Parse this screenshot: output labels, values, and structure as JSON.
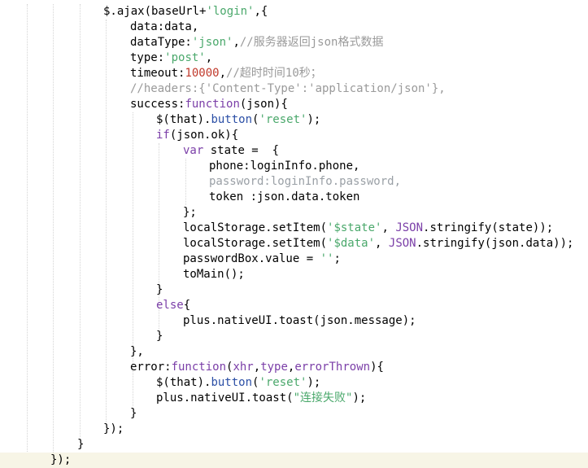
{
  "editor": {
    "language": "javascript",
    "colors": {
      "string": "#4aa86b",
      "comment": "#9a9a9a",
      "number": "#c0392b",
      "keyword": "#7b3fa8",
      "function": "#2b4fa6",
      "active_line_bg": "#f7f5e6"
    },
    "lines": [
      {
        "indent": 4,
        "tokens": [
          {
            "t": "$.ajax(baseUrl+"
          },
          {
            "t": "'login'",
            "c": "str"
          },
          {
            "t": ",{"
          }
        ]
      },
      {
        "indent": 5,
        "tokens": [
          {
            "t": "data:data,"
          }
        ]
      },
      {
        "indent": 5,
        "tokens": [
          {
            "t": "dataType:"
          },
          {
            "t": "'json'",
            "c": "str"
          },
          {
            "t": ","
          },
          {
            "t": "//服务器返回json格式数据",
            "c": "cmt"
          }
        ]
      },
      {
        "indent": 5,
        "tokens": [
          {
            "t": "type:"
          },
          {
            "t": "'post'",
            "c": "str"
          },
          {
            "t": ","
          }
        ]
      },
      {
        "indent": 5,
        "tokens": [
          {
            "t": "timeout:"
          },
          {
            "t": "10000",
            "c": "num"
          },
          {
            "t": ","
          },
          {
            "t": "//超时时间10秒；",
            "c": "cmt"
          }
        ]
      },
      {
        "indent": 5,
        "tokens": [
          {
            "t": "//headers:{'Content-Type':'application/json'},",
            "c": "cmt"
          }
        ]
      },
      {
        "indent": 5,
        "tokens": [
          {
            "t": "success:"
          },
          {
            "t": "function",
            "c": "kw"
          },
          {
            "t": "(json){"
          }
        ]
      },
      {
        "indent": 6,
        "tokens": [
          {
            "t": "$(that)."
          },
          {
            "t": "button",
            "c": "fn"
          },
          {
            "t": "("
          },
          {
            "t": "'reset'",
            "c": "str"
          },
          {
            "t": ");"
          }
        ]
      },
      {
        "indent": 6,
        "tokens": [
          {
            "t": "if",
            "c": "kw"
          },
          {
            "t": "(json.ok){"
          }
        ]
      },
      {
        "indent": 7,
        "tokens": [
          {
            "t": "var",
            "c": "kw"
          },
          {
            "t": " state =  {"
          }
        ]
      },
      {
        "indent": 8,
        "tokens": [
          {
            "t": "phone:loginInfo.phone,"
          }
        ]
      },
      {
        "indent": 8,
        "tokens": [
          {
            "t": "password:loginInfo.password,",
            "c": "dim"
          }
        ]
      },
      {
        "indent": 8,
        "tokens": [
          {
            "t": "token :json.data.token"
          }
        ]
      },
      {
        "indent": 7,
        "tokens": [
          {
            "t": "};"
          }
        ]
      },
      {
        "indent": 7,
        "tokens": [
          {
            "t": "localStorage.setItem("
          },
          {
            "t": "'$state'",
            "c": "str"
          },
          {
            "t": ", "
          },
          {
            "t": "JSON",
            "c": "kw"
          },
          {
            "t": ".stringify(state));"
          }
        ]
      },
      {
        "indent": 7,
        "tokens": [
          {
            "t": "localStorage.setItem("
          },
          {
            "t": "'$data'",
            "c": "str"
          },
          {
            "t": ", "
          },
          {
            "t": "JSON",
            "c": "kw"
          },
          {
            "t": ".stringify(json.data));"
          }
        ]
      },
      {
        "indent": 7,
        "tokens": [
          {
            "t": "passwordBox.value = "
          },
          {
            "t": "''",
            "c": "str"
          },
          {
            "t": ";"
          }
        ]
      },
      {
        "indent": 7,
        "tokens": [
          {
            "t": "toMain();"
          }
        ]
      },
      {
        "indent": 6,
        "tokens": [
          {
            "t": "}"
          }
        ]
      },
      {
        "indent": 6,
        "tokens": [
          {
            "t": "else",
            "c": "kw"
          },
          {
            "t": "{"
          }
        ]
      },
      {
        "indent": 7,
        "tokens": [
          {
            "t": "plus.nativeUI.toast(json.message);"
          }
        ]
      },
      {
        "indent": 6,
        "tokens": [
          {
            "t": "}"
          }
        ]
      },
      {
        "indent": 5,
        "tokens": [
          {
            "t": "},"
          }
        ]
      },
      {
        "indent": 5,
        "tokens": [
          {
            "t": "error:"
          },
          {
            "t": "function",
            "c": "kw"
          },
          {
            "t": "("
          },
          {
            "t": "xhr",
            "c": "var"
          },
          {
            "t": ","
          },
          {
            "t": "type",
            "c": "var"
          },
          {
            "t": ","
          },
          {
            "t": "errorThrown",
            "c": "var"
          },
          {
            "t": "){"
          }
        ]
      },
      {
        "indent": 6,
        "tokens": [
          {
            "t": "$(that)."
          },
          {
            "t": "button",
            "c": "fn"
          },
          {
            "t": "("
          },
          {
            "t": "'reset'",
            "c": "str"
          },
          {
            "t": ");"
          }
        ]
      },
      {
        "indent": 6,
        "tokens": [
          {
            "t": "plus.nativeUI.toast("
          },
          {
            "t": "\"连接失败\"",
            "c": "str"
          },
          {
            "t": ");"
          }
        ]
      },
      {
        "indent": 5,
        "tokens": [
          {
            "t": "}"
          }
        ]
      },
      {
        "indent": 4,
        "tokens": [
          {
            "t": "});"
          }
        ]
      },
      {
        "indent": 3,
        "tokens": [
          {
            "t": "}"
          }
        ]
      },
      {
        "indent": 2,
        "tokens": [
          {
            "t": "});"
          }
        ],
        "active": true
      }
    ]
  }
}
